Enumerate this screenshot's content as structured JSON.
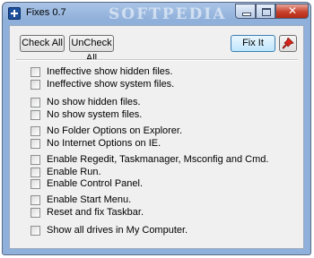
{
  "window": {
    "title": "Fixes 0.7",
    "watermark": "SOFTPEDIA",
    "controls": {
      "minimize": "–",
      "maximize": "□",
      "close": "✕"
    }
  },
  "toolbar": {
    "check_all_label": "Check All",
    "uncheck_all_label": "UnCheck All",
    "fix_it_label": "Fix It",
    "pin_icon": "pin-icon"
  },
  "options": [
    {
      "label": "Ineffective show hidden files.",
      "checked": false
    },
    {
      "label": "Ineffective show system files.",
      "checked": false
    },
    {
      "label": "No show hidden files.",
      "checked": false
    },
    {
      "label": "No show system files.",
      "checked": false
    },
    {
      "label": "No Folder Options on Explorer.",
      "checked": false
    },
    {
      "label": "No Internet Options on IE.",
      "checked": false
    },
    {
      "label": "Enable Regedit, Taskmanager, Msconfig and Cmd.",
      "checked": false
    },
    {
      "label": "Enable Run.",
      "checked": false
    },
    {
      "label": "Enable Control Panel.",
      "checked": false
    },
    {
      "label": "Enable Start Menu.",
      "checked": false
    },
    {
      "label": "Reset and fix Taskbar.",
      "checked": false
    },
    {
      "label": "Show all drives in My Computer.",
      "checked": false
    }
  ]
}
